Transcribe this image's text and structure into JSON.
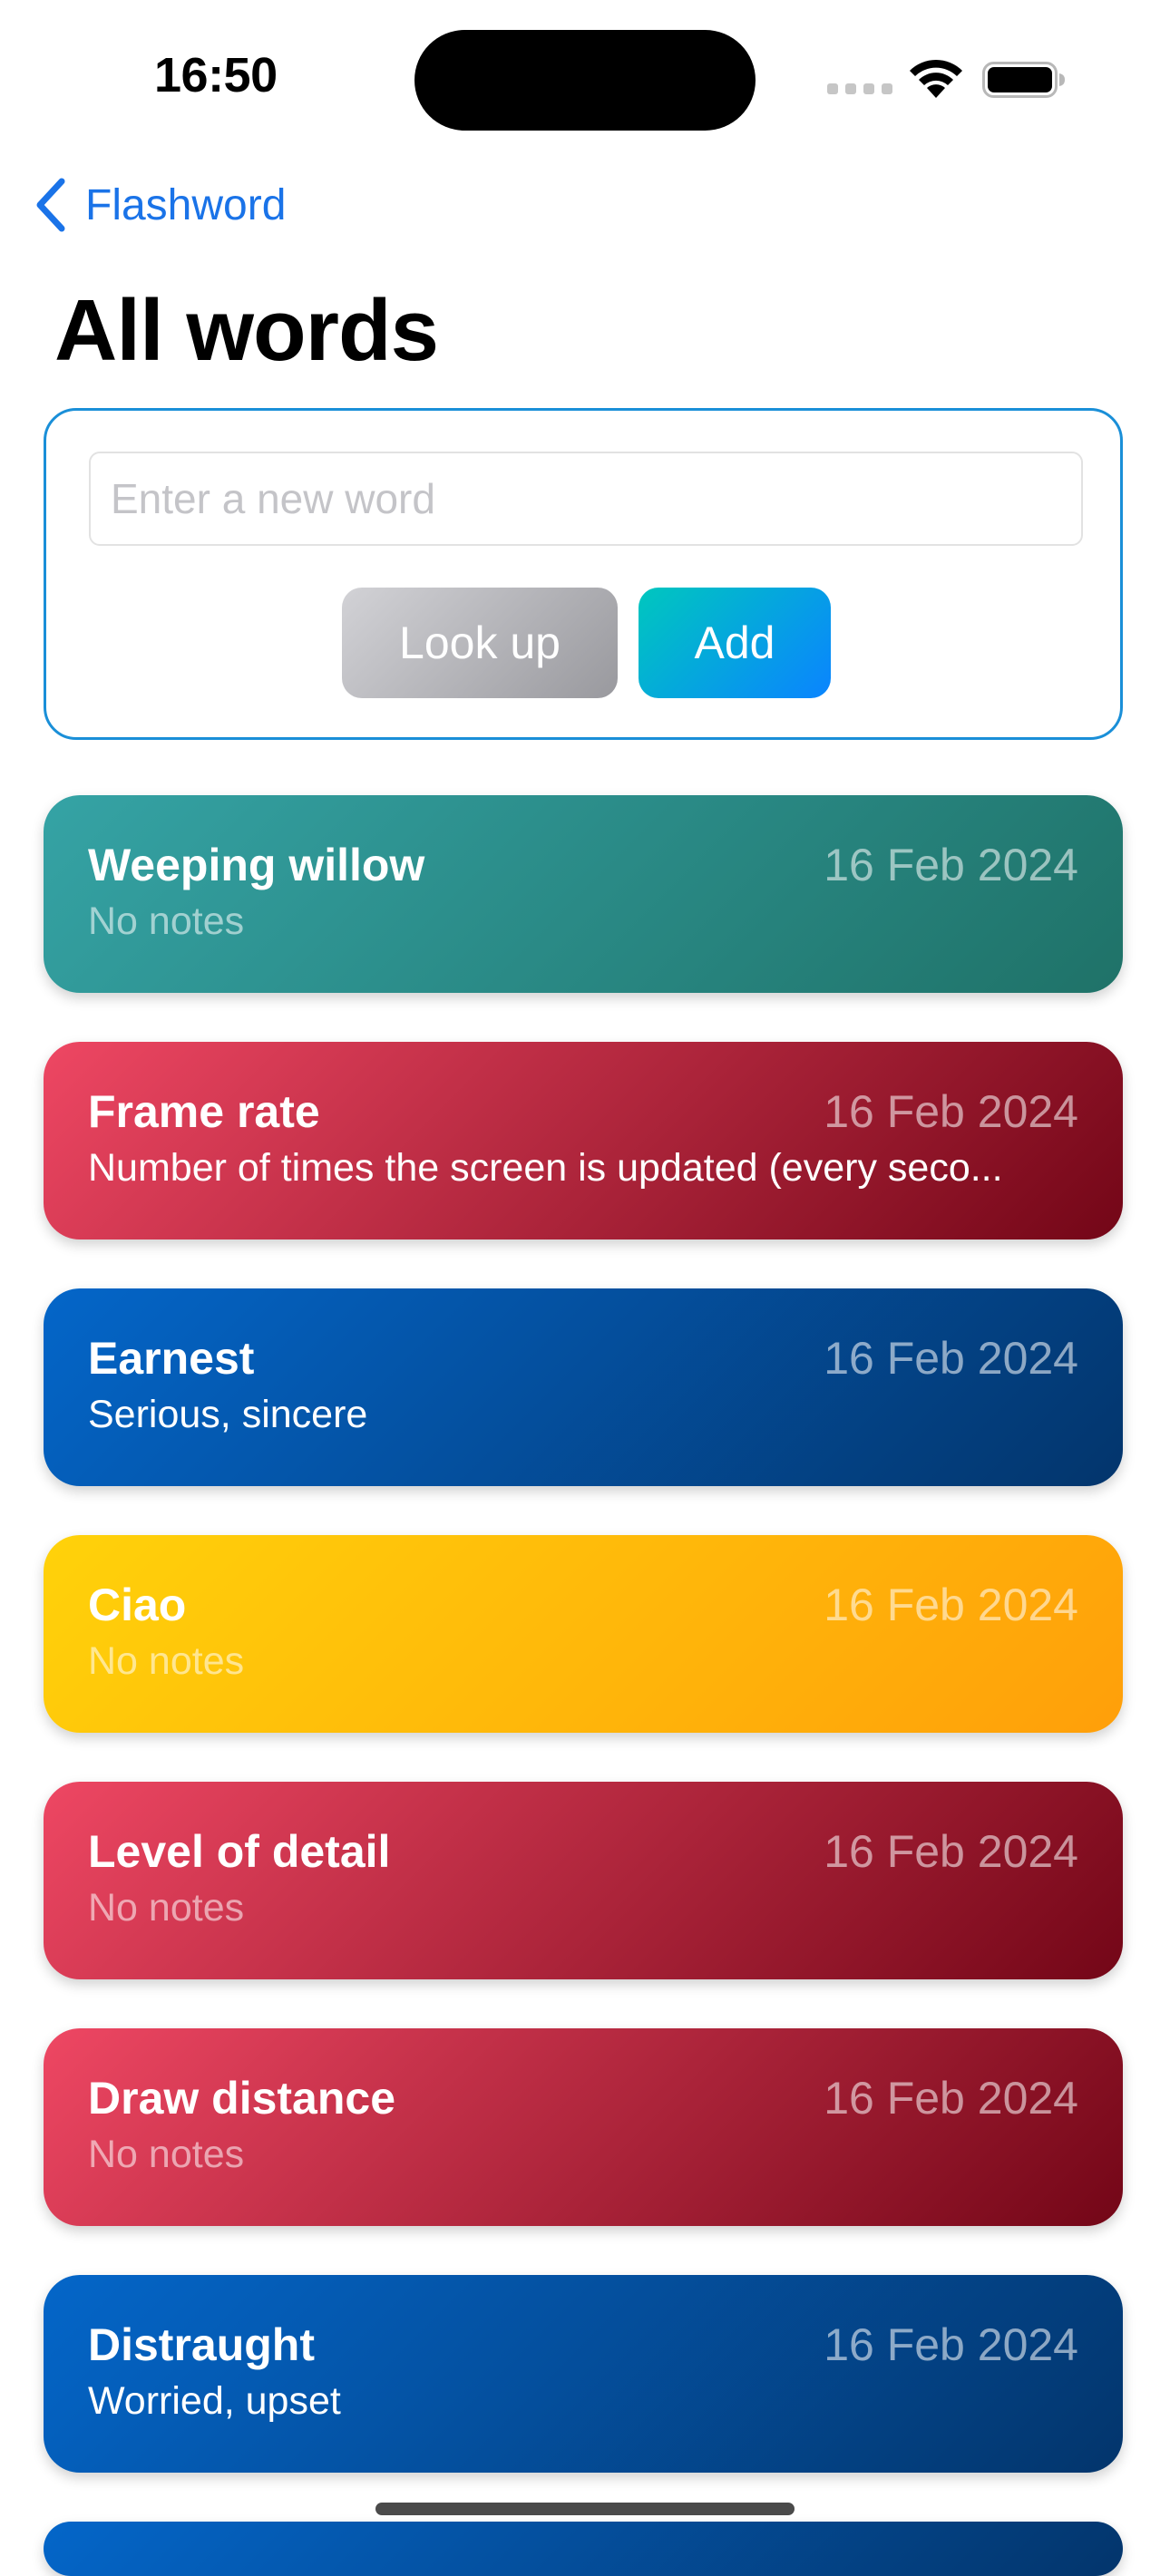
{
  "status_bar": {
    "time": "16:50"
  },
  "nav": {
    "back_label": "Flashword",
    "title": "All words"
  },
  "add_panel": {
    "input_value": "",
    "input_placeholder": "Enter a new word",
    "lookup_label": "Look up",
    "add_label": "Add"
  },
  "colors": {
    "accent": "#1a73e8",
    "teal": "#35a3a5",
    "red": "#ee4763",
    "blue": "#0466c9",
    "yellow": "#ffd20a"
  },
  "words": [
    {
      "title": "Weeping willow",
      "date": "16 Feb 2024",
      "notes": "No notes",
      "color": "teal"
    },
    {
      "title": "Frame rate",
      "date": "16 Feb 2024",
      "notes": "Number of times the screen is updated (every seco...",
      "color": "red"
    },
    {
      "title": "Earnest",
      "date": "16 Feb 2024",
      "notes": "Serious, sincere",
      "color": "blue"
    },
    {
      "title": "Ciao",
      "date": "16 Feb 2024",
      "notes": "No notes",
      "color": "yellow"
    },
    {
      "title": "Level of detail",
      "date": "16 Feb 2024",
      "notes": "No notes",
      "color": "red"
    },
    {
      "title": "Draw distance",
      "date": "16 Feb 2024",
      "notes": "No notes",
      "color": "red"
    },
    {
      "title": "Distraught",
      "date": "16 Feb 2024",
      "notes": "Worried, upset",
      "color": "blue"
    }
  ]
}
